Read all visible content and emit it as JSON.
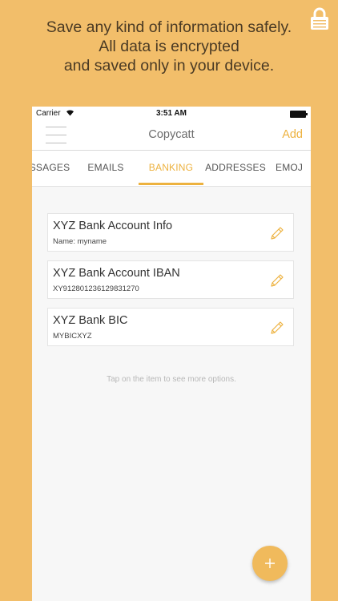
{
  "promo": {
    "lines": [
      "Save any kind of information safely.",
      "All data is encrypted",
      "and saved only in your device."
    ],
    "badge_icon": "lock-icon"
  },
  "statusbar": {
    "carrier": "Carrier",
    "time": "3:51 AM",
    "wifi_icon": "wifi-icon",
    "battery_icon": "battery-icon"
  },
  "navbar": {
    "menu_icon": "hamburger-menu-icon",
    "title": "Copycatt",
    "add_label": "Add"
  },
  "tabs": [
    {
      "label": "SSAGES",
      "active": false
    },
    {
      "label": "EMAILS",
      "active": false
    },
    {
      "label": "BANKING",
      "active": true
    },
    {
      "label": "ADDRESSES",
      "active": false
    },
    {
      "label": "EMOJ",
      "active": false
    }
  ],
  "items": [
    {
      "title": "XYZ Bank Account Info",
      "subtitle": "Name: myname"
    },
    {
      "title": "XYZ Bank Account IBAN",
      "subtitle": "XY912801236129831270"
    },
    {
      "title": "XYZ Bank BIC",
      "subtitle": "MYBICXYZ"
    }
  ],
  "hint": "Tap on the item to see more options.",
  "fab_icon": "plus-icon",
  "colors": {
    "background": "#F2BE6A",
    "accent": "#EDB23F"
  }
}
